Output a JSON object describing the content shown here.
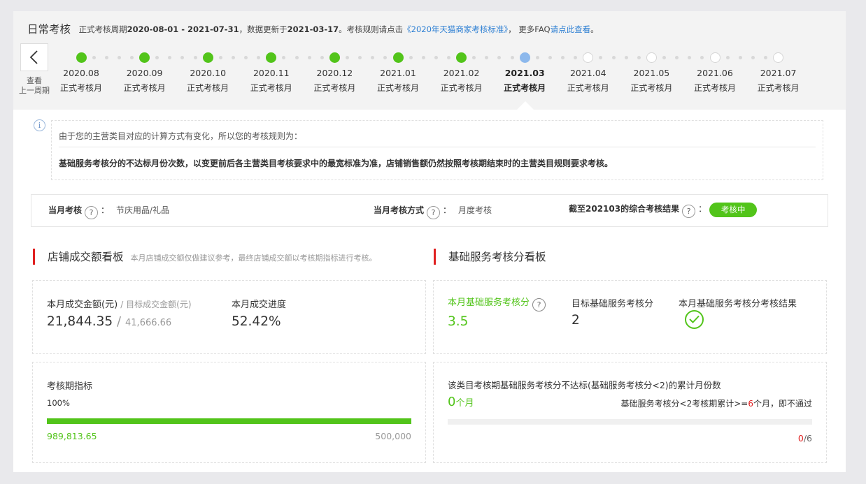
{
  "header": {
    "title": "日常考核",
    "period_prefix": "正式考核周期",
    "period_range": "2020-08-01 - 2021-07-31",
    "update_prefix": "，数据更新于",
    "update_date": "2021-03-17",
    "rule_prefix": "。考核规则请点击",
    "rule_link": "《2020年天猫商家考核标准》",
    "faq_prefix": "， 更多FAQ",
    "faq_link": "请点此查看",
    "faq_suffix": "。"
  },
  "timeline": {
    "prev_label_1": "查看",
    "prev_label_2": "上一周期",
    "months": [
      {
        "month": "2020.08",
        "type": "正式考核月",
        "status": "done"
      },
      {
        "month": "2020.09",
        "type": "正式考核月",
        "status": "done"
      },
      {
        "month": "2020.10",
        "type": "正式考核月",
        "status": "done"
      },
      {
        "month": "2020.11",
        "type": "正式考核月",
        "status": "done"
      },
      {
        "month": "2020.12",
        "type": "正式考核月",
        "status": "done"
      },
      {
        "month": "2021.01",
        "type": "正式考核月",
        "status": "done"
      },
      {
        "month": "2021.02",
        "type": "正式考核月",
        "status": "done"
      },
      {
        "month": "2021.03",
        "type": "正式考核月",
        "status": "current"
      },
      {
        "month": "2021.04",
        "type": "正式考核月",
        "status": "future"
      },
      {
        "month": "2021.05",
        "type": "正式考核月",
        "status": "future"
      },
      {
        "month": "2021.06",
        "type": "正式考核月",
        "status": "future"
      },
      {
        "month": "2021.07",
        "type": "正式考核月",
        "status": "future"
      }
    ],
    "colors": {
      "done": "#52c41a",
      "current": "#8cb8ec",
      "future": "#d5d5d5"
    }
  },
  "notice": {
    "line1": "由于您的主营类目对应的计算方式有变化，所以您的考核规则为：",
    "line2": "基础服务考核分的不达标月份次数，以变更前后各主营类目考核要求中的最宽标准为准，店铺销售额仍然按照考核期结束时的主营类目规则要求考核。"
  },
  "summary": {
    "month_label": "当月考核",
    "month_value": "节庆用品/礼品",
    "method_label": "当月考核方式",
    "method_value": "月度考核",
    "result_label": "截至202103的综合考核结果",
    "result_badge": "考核中",
    "colon": "："
  },
  "sales": {
    "title": "店铺成交额看板",
    "note": "本月店铺成交额仅做建议参考，最终店铺成交额以考核期指标进行考核。",
    "amount_label": "本月成交金额(元)",
    "target_label": "/ 目标成交金额(元)",
    "amount_value": "21,844.35",
    "slash": "/",
    "target_value": "41,666.66",
    "progress_label": "本月成交进度",
    "progress_value": "52.42%",
    "period_label": "考核期指标",
    "period_percent": "100%",
    "period_progress": 1.0,
    "period_actual": "989,813.65",
    "period_target": "500,000"
  },
  "service": {
    "title": "基础服务考核分看板",
    "score_label": "本月基础服务考核分",
    "score_value": "3.5",
    "target_label": "目标基础服务考核分",
    "target_value": "2",
    "result_label": "本月基础服务考核分考核结果",
    "fail_label": "该类目考核期基础服务考核分不达标(基础服务考核分<2)的累计月份数",
    "fail_count": "0",
    "fail_unit": "个月",
    "rule_prefix": "基础服务考核分<2考核期累计>=",
    "rule_count": "6",
    "rule_suffix": "个月，即不通过",
    "ratio_current": "0",
    "ratio_total": "/6",
    "fail_progress": 0
  },
  "icons": {
    "question": "?",
    "info": "i"
  },
  "colors": {
    "accent_green": "#52c41a",
    "accent_red": "#e02020",
    "link_blue": "#2d7fd3"
  }
}
